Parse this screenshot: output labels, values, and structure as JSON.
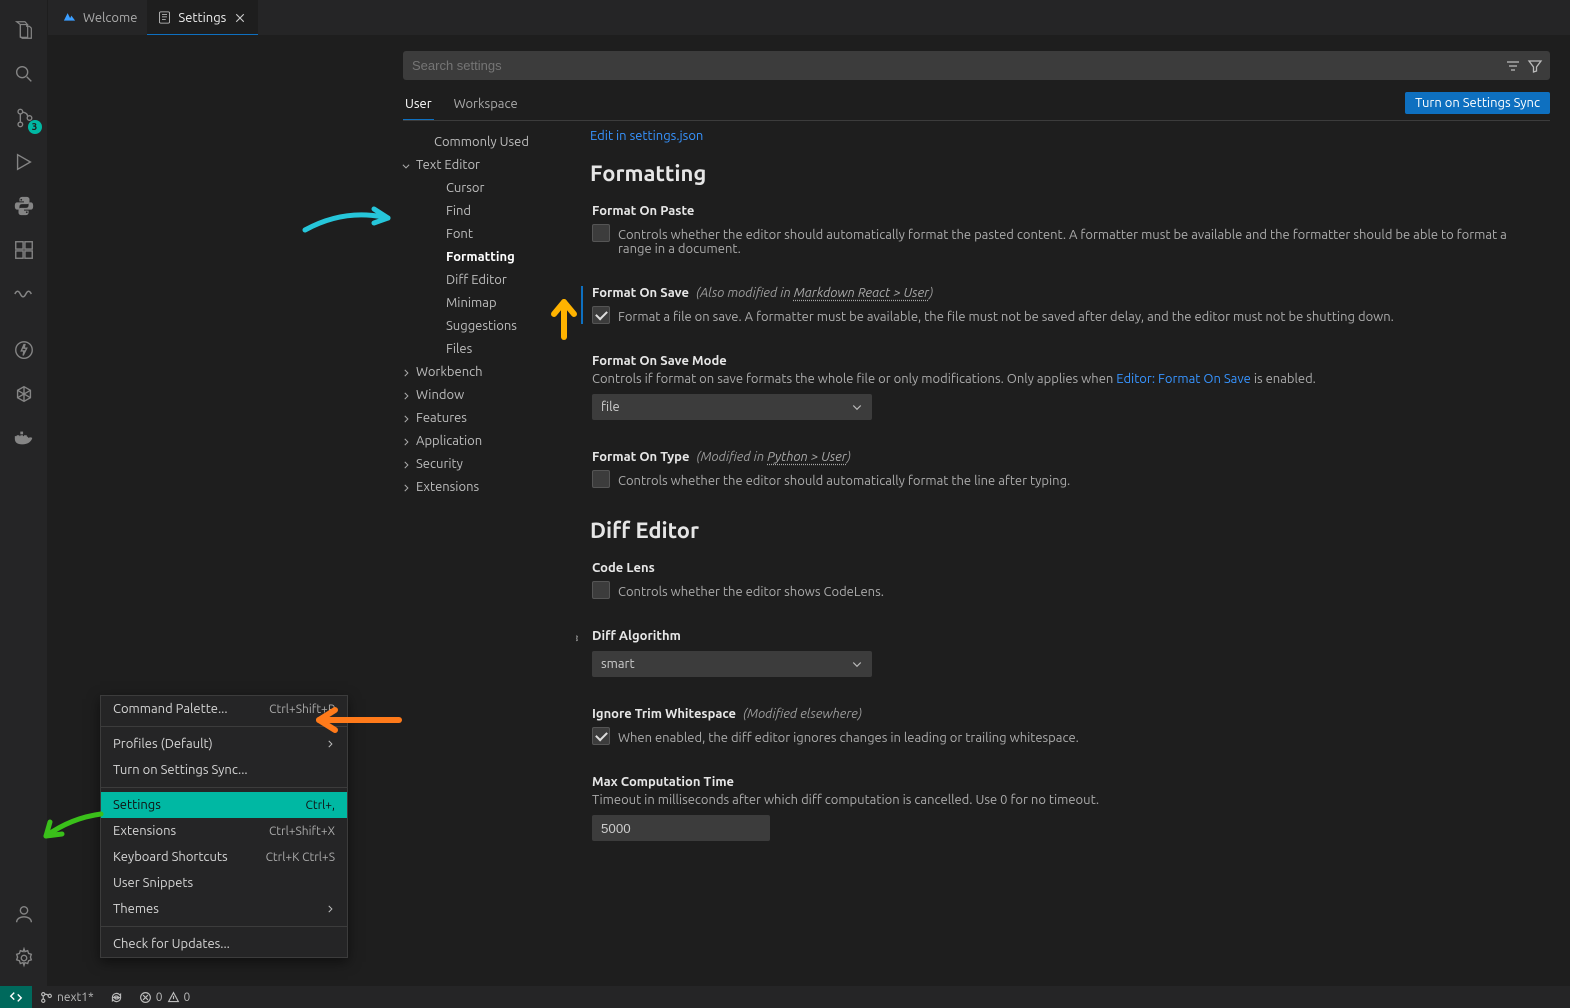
{
  "tabs": {
    "welcome": "Welcome",
    "settings": "Settings"
  },
  "search": {
    "placeholder": "Search settings"
  },
  "scope": {
    "user": "User",
    "workspace": "Workspace",
    "sync_btn": "Turn on Settings Sync"
  },
  "edit_json": "Edit in settings.json",
  "source_control_badge": "3",
  "toc": {
    "commonly_used": "Commonly Used",
    "text_editor": "Text Editor",
    "cursor": "Cursor",
    "find": "Find",
    "font": "Font",
    "formatting": "Formatting",
    "diff_editor": "Diff Editor",
    "minimap": "Minimap",
    "suggestions": "Suggestions",
    "files": "Files",
    "workbench": "Workbench",
    "window": "Window",
    "features": "Features",
    "application": "Application",
    "security": "Security",
    "extensions": "Extensions"
  },
  "sections": {
    "formatting": "Formatting",
    "diff_editor": "Diff Editor"
  },
  "settings": {
    "format_on_paste": {
      "title": "Format On Paste",
      "desc": "Controls whether the editor should automatically format the pasted content. A formatter must be available and the formatter should be able to format a range in a document."
    },
    "format_on_save": {
      "title": "Format On Save",
      "note_prefix": "(Also modified in ",
      "note_link": "Markdown React > User",
      "note_suffix": ")",
      "desc": "Format a file on save. A formatter must be available, the file must not be saved after delay, and the editor must not be shutting down."
    },
    "format_on_save_mode": {
      "title": "Format On Save Mode",
      "desc_a": "Controls if format on save formats the whole file or only modifications. Only applies when ",
      "desc_link": "Editor: Format On Save",
      "desc_b": " is enabled.",
      "value": "file"
    },
    "format_on_type": {
      "title": "Format On Type",
      "note_prefix": "(Modified in ",
      "note_link": "Python > User",
      "note_suffix": ")",
      "desc": "Controls whether the editor should automatically format the line after typing."
    },
    "code_lens": {
      "title": "Code Lens",
      "desc": "Controls whether the editor shows CodeLens."
    },
    "diff_algorithm": {
      "title": "Diff Algorithm",
      "value": "smart"
    },
    "ignore_trim": {
      "title": "Ignore Trim Whitespace",
      "note": "(Modified elsewhere)",
      "desc": "When enabled, the diff editor ignores changes in leading or trailing whitespace."
    },
    "max_comp_time": {
      "title": "Max Computation Time",
      "desc": "Timeout in milliseconds after which diff computation is cancelled. Use 0 for no timeout.",
      "value": "5000"
    }
  },
  "menu": {
    "command_palette": "Command Palette...",
    "command_palette_kb": "Ctrl+Shift+P",
    "profiles": "Profiles (Default)",
    "turn_on_sync": "Turn on Settings Sync...",
    "settings": "Settings",
    "settings_kb": "Ctrl+,",
    "extensions": "Extensions",
    "extensions_kb": "Ctrl+Shift+X",
    "keyboard": "Keyboard Shortcuts",
    "keyboard_kb": "Ctrl+K Ctrl+S",
    "snippets": "User Snippets",
    "themes": "Themes",
    "check_updates": "Check for Updates..."
  },
  "status": {
    "branch": "next1*",
    "errors": "0",
    "warnings": "0"
  }
}
